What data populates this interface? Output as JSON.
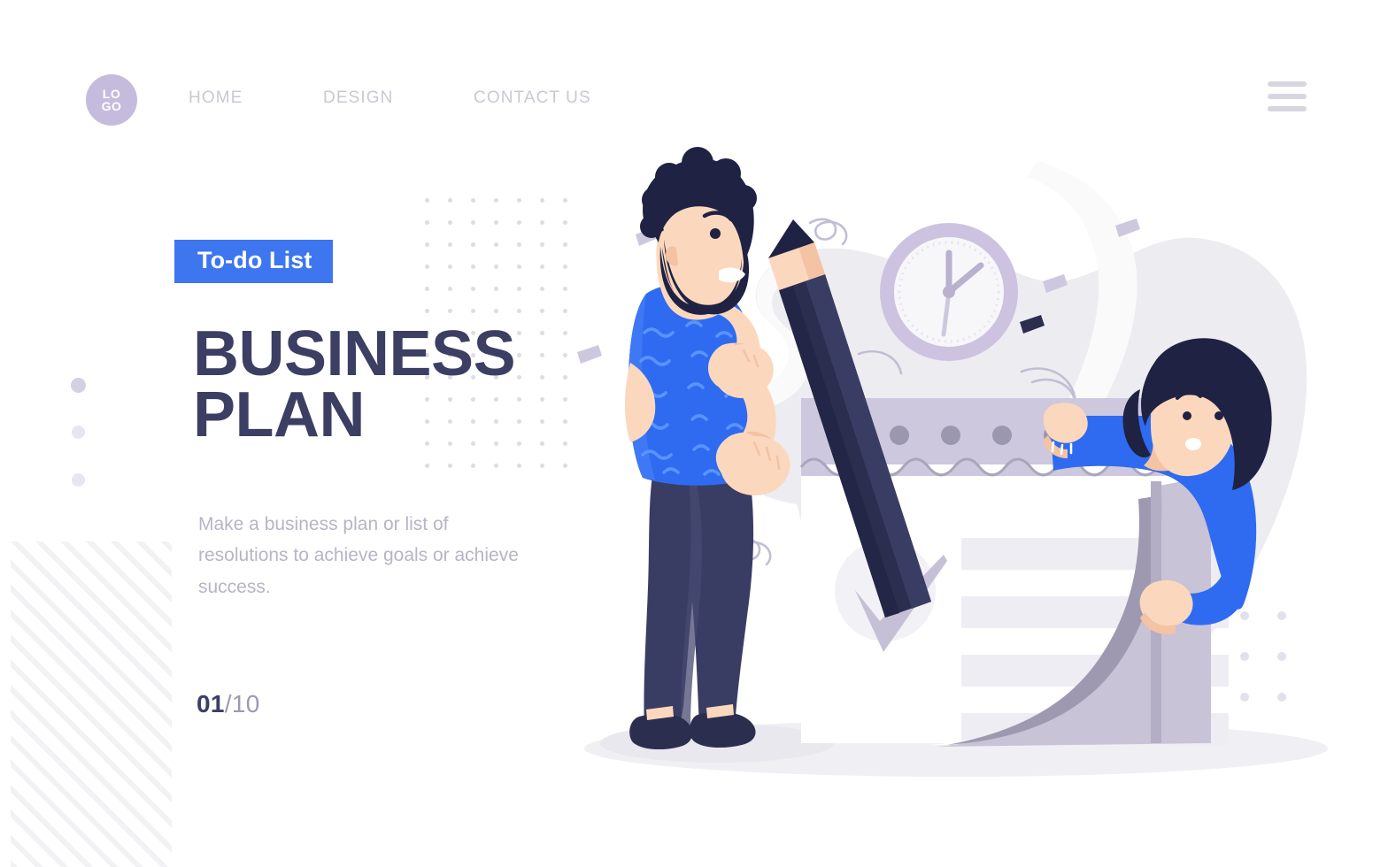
{
  "nav": {
    "logo": {
      "line1": "LO",
      "line2": "GO",
      "name": "logo"
    },
    "links": [
      {
        "label": "HOME"
      },
      {
        "label": "DESIGN"
      },
      {
        "label": "CONTACT US"
      }
    ],
    "menu_icon": "hamburger-menu-icon"
  },
  "hero": {
    "badge": "To-do List",
    "title_line1": "BUSINESS",
    "title_line2": "PLAN",
    "description": "Make a business plan or list of resolutions to achieve goals or achieve success.",
    "slide_current": "01",
    "slide_total": "/10"
  },
  "illustration": {
    "name": "business-plan-illustration",
    "elements": [
      "man-holding-pencil",
      "woman-behind-checklist",
      "checklist-paper",
      "wall-clock",
      "confetti",
      "squiggles"
    ]
  },
  "colors": {
    "accent_blue": "#3d76ee",
    "bright_blue": "#2f6bf0",
    "headline_navy": "#3c3f63",
    "body_grey": "#b6b5c6",
    "nav_grey": "#c9c8d6",
    "logo_purple": "#c5bcdd",
    "lavender": "#cdc8de",
    "paper_white": "#ffffff",
    "bg_blob": "#ebeaf0",
    "skin": "#f7cfb4",
    "dark_navy": "#2b2e4f"
  }
}
